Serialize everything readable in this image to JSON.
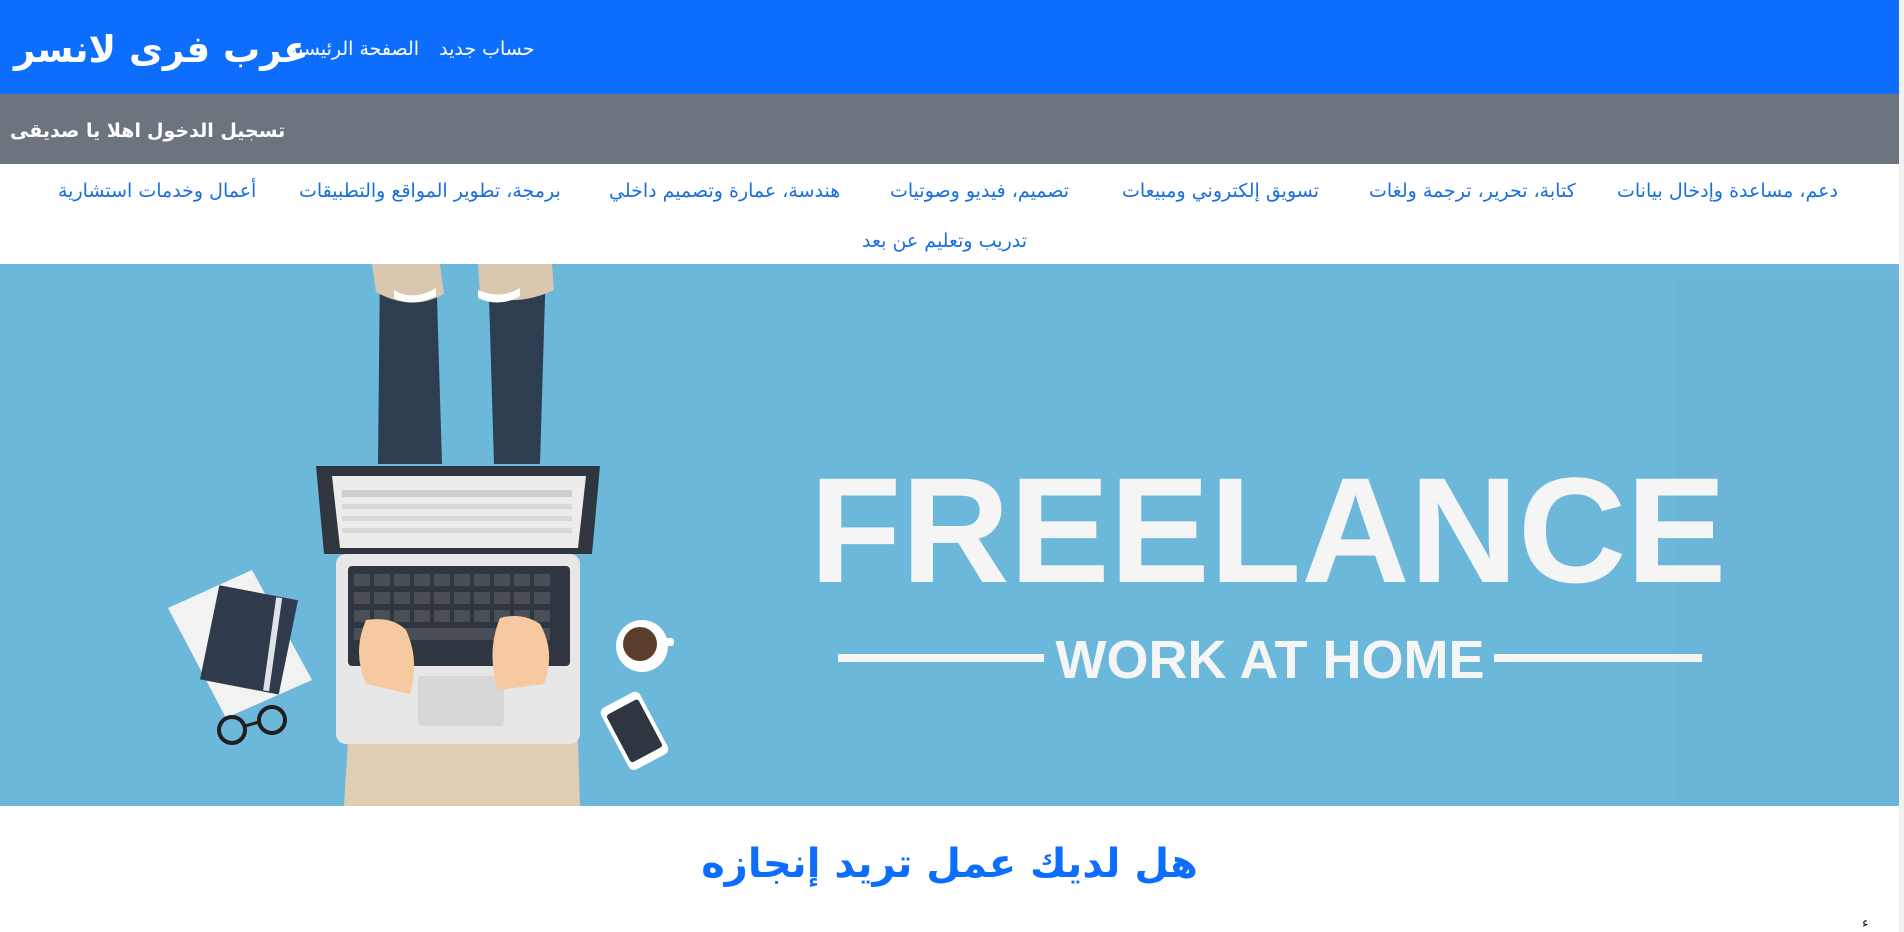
{
  "navbar": {
    "brand": "عرب فرى لانسر",
    "links": [
      "الصفحة الرئيسية",
      "حساب جديد"
    ],
    "bg_color": "#0d6efd"
  },
  "userbar": {
    "login": "تسجيل الدخول",
    "greeting": "اهلا يا صديقى",
    "bg_color": "#6c757d"
  },
  "categories": [
    "دعم، مساعدة وإدخال بيانات",
    "كتابة، تحرير، ترجمة ولغات",
    "تسويق إلكتروني ومبيعات",
    "تصميم، فيديو وصوتيات",
    "هندسة، عمارة وتصميم داخلي",
    "برمجة، تطوير المواقع والتطبيقات",
    "أعمال وخدمات استشارية",
    "تدريب وتعليم عن بعد"
  ],
  "hero": {
    "headline": "FREELANCE",
    "subline": "WORK AT HOME",
    "bg_color": "#6cb8db"
  },
  "main": {
    "question": "هل لديك عمل تريد إنجازه",
    "edge_glyph": "ء"
  }
}
